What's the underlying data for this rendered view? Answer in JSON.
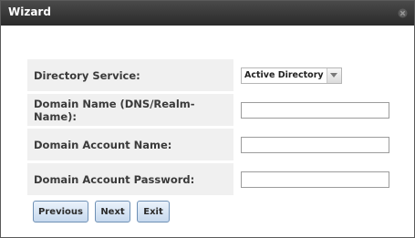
{
  "window": {
    "title": "Wizard"
  },
  "form": {
    "directory_service": {
      "label": "Directory Service:",
      "value": "Active Directory"
    },
    "domain_name": {
      "label": "Domain Name (DNS/Realm-Name):",
      "value": ""
    },
    "account_name": {
      "label": "Domain Account Name:",
      "value": ""
    },
    "account_password": {
      "label": "Domain Account Password:",
      "value": ""
    }
  },
  "buttons": {
    "previous": "Previous",
    "next": "Next",
    "exit": "Exit"
  },
  "icons": {
    "close": "close-icon",
    "dropdown": "chevron-down-icon"
  },
  "colors": {
    "titlebar": "#333333",
    "button_border": "#6e90b5",
    "label_bg": "#f0f0f0"
  }
}
